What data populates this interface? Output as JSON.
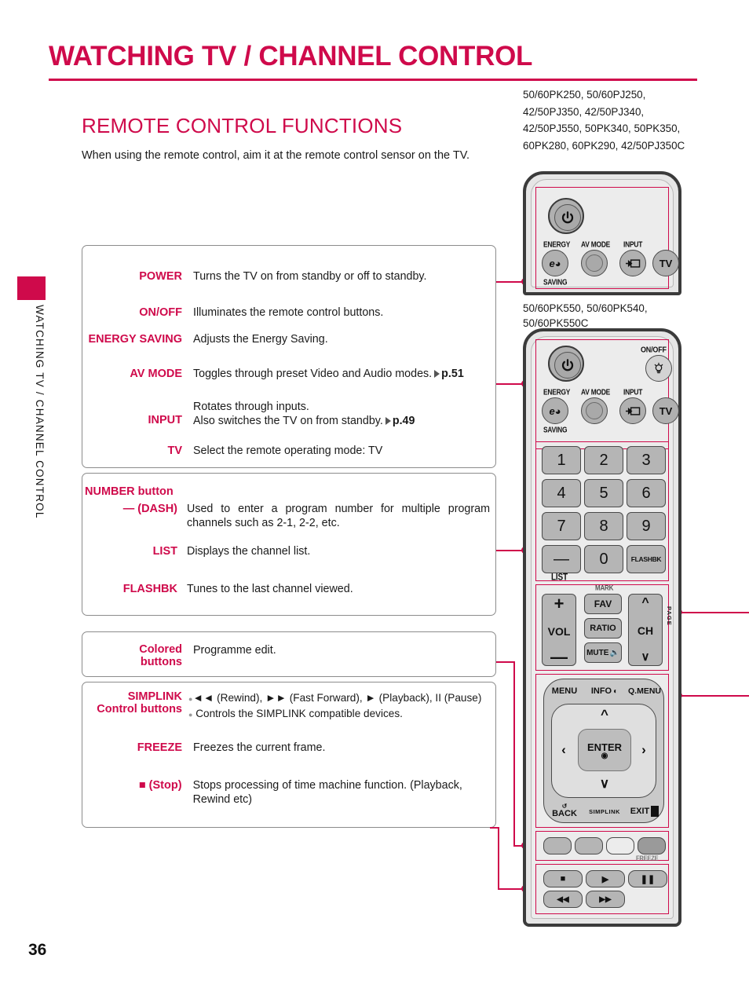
{
  "header": {
    "main_title": "WATCHING TV / CHANNEL CONTROL",
    "section_title": "REMOTE CONTROL FUNCTIONS",
    "intro": "When using the remote control, aim it at the remote control sensor on the TV."
  },
  "side_tab": {
    "text": "WATCHING TV / CHANNEL CONTROL"
  },
  "page_number": "36",
  "model_lists": {
    "top": "50/60PK250, 50/60PJ250, 42/50PJ350, 42/50PJ340, 42/50PJ550, 50PK340, 50PK350, 60PK280, 60PK290, 42/50PJ350C",
    "main": "50/60PK550, 50/60PK540, 50/60PK550C"
  },
  "boxes": {
    "power": [
      {
        "label": "POWER",
        "desc": "Turns the TV on from standby or off to standby."
      },
      {
        "label": "ON/OFF",
        "desc": "Illuminates the remote control buttons."
      },
      {
        "label": "ENERGY SAVING",
        "desc": "Adjusts the Energy Saving."
      },
      {
        "label": "AV MODE",
        "desc": "Toggles through preset Video and Audio modes.",
        "ref": "p.51"
      },
      {
        "label": "INPUT",
        "desc": "Rotates through inputs.",
        "desc2": "Also switches the TV on from standby.",
        "ref": "p.49"
      },
      {
        "label": "TV",
        "desc": "Select the remote operating mode: TV"
      }
    ],
    "number": [
      {
        "label": "NUMBER button",
        "desc": ""
      },
      {
        "label": "— (DASH)",
        "desc": "Used to enter a program number for multiple program channels such as 2-1, 2-2, etc."
      },
      {
        "label": "LIST",
        "desc": "Displays the channel list."
      },
      {
        "label": "FLASHBK",
        "desc": "Tunes to the last channel viewed."
      }
    ],
    "colored": [
      {
        "label": "Colored buttons",
        "desc": "Programme edit."
      }
    ],
    "simplink": [
      {
        "label": "SIMPLINK Control buttons",
        "desc": "◄◄ (Rewind), ►► (Fast Forward), ► (Playback), II (Pause)",
        "desc2": "Controls the SIMPLINK compatible devices."
      },
      {
        "label": "FREEZE",
        "desc": "Freezes the current frame."
      },
      {
        "label": "■ (Stop)",
        "desc": "Stops processing of time machine function. (Playback, Rewind etc)"
      }
    ]
  },
  "remote": {
    "top_unit": {
      "captions": [
        "ENERGY",
        "SAVING",
        "AV MODE",
        "INPUT"
      ],
      "tv_button": "TV"
    },
    "main_unit": {
      "onoff_label": "ON/OFF",
      "captions": [
        "ENERGY",
        "SAVING",
        "AV MODE",
        "INPUT"
      ],
      "tv_button": "TV",
      "numbers": [
        "1",
        "2",
        "3",
        "4",
        "5",
        "6",
        "7",
        "8",
        "9",
        "—",
        "0",
        "FLASHBK"
      ],
      "list_label": "LIST",
      "mark_label": "MARK",
      "vol_label": "VOL",
      "ch_label": "CH",
      "page_label": "PAGE",
      "fav_label": "FAV",
      "ratio_label": "RATIO",
      "mute_label": "MUTE",
      "menu_label": "MENU",
      "info_label": "INFO",
      "qmenu_label": "Q.MENU",
      "enter_label": "ENTER",
      "back_label": "BACK",
      "simplink_label": "SIMPLINK",
      "exit_label": "EXIT",
      "freeze_label": "FREEZE"
    }
  },
  "colors": {
    "accent": "#cf0a4b",
    "text": "#1a1a1a",
    "remote_body": "#e6e6e6",
    "button": "#b5b5b5"
  }
}
